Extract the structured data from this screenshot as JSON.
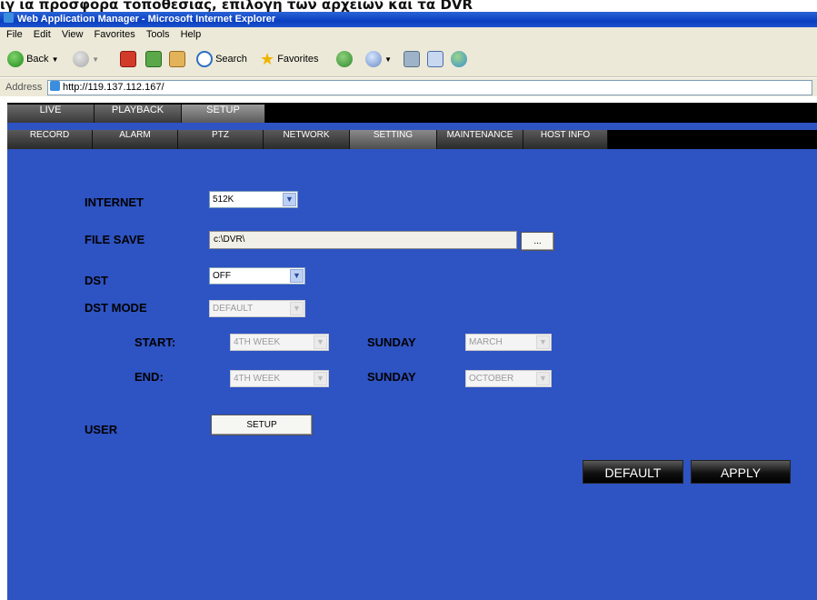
{
  "caption_text": "ιγ ια προσφορα τοποθεσιας, επιλογη των αρχειων και τα DVR",
  "window": {
    "title": "Web Application Manager - Microsoft Internet Explorer"
  },
  "menu": [
    "File",
    "Edit",
    "View",
    "Favorites",
    "Tools",
    "Help"
  ],
  "toolbar": {
    "back_label": "Back",
    "search_label": "Search",
    "favorites_label": "Favorites"
  },
  "address": {
    "label": "Address",
    "url": "http://119.137.112.167/"
  },
  "main_tabs": [
    "LIVE",
    "PLAYBACK",
    "SETUP"
  ],
  "sub_tabs": [
    "RECORD",
    "ALARM",
    "PTZ",
    "NETWORK",
    "SETTING",
    "MAINTENANCE",
    "HOST INFO"
  ],
  "form": {
    "internet_label": "INTERNET",
    "internet_value": "512K",
    "file_save_label": "FILE SAVE",
    "file_save_value": "c:\\DVR\\",
    "browse_label": "...",
    "dst_label": "DST",
    "dst_value": "OFF",
    "dst_mode_label": "DST MODE",
    "dst_mode_value": "DEFAULT",
    "start_label": "START:",
    "start_week": "4TH WEEK",
    "start_day": "SUNDAY",
    "start_month": "MARCH",
    "end_label": "END:",
    "end_week": "4TH WEEK",
    "end_day": "SUNDAY",
    "end_month": "OCTOBER",
    "user_label": "USER",
    "user_setup_label": "SETUP"
  },
  "buttons": {
    "default_label": "DEFAULT",
    "apply_label": "APPLY"
  },
  "colors": {
    "app_background": "#2e53c2",
    "titlebar": "#0a3fc0",
    "tab_bar": "#000000"
  }
}
